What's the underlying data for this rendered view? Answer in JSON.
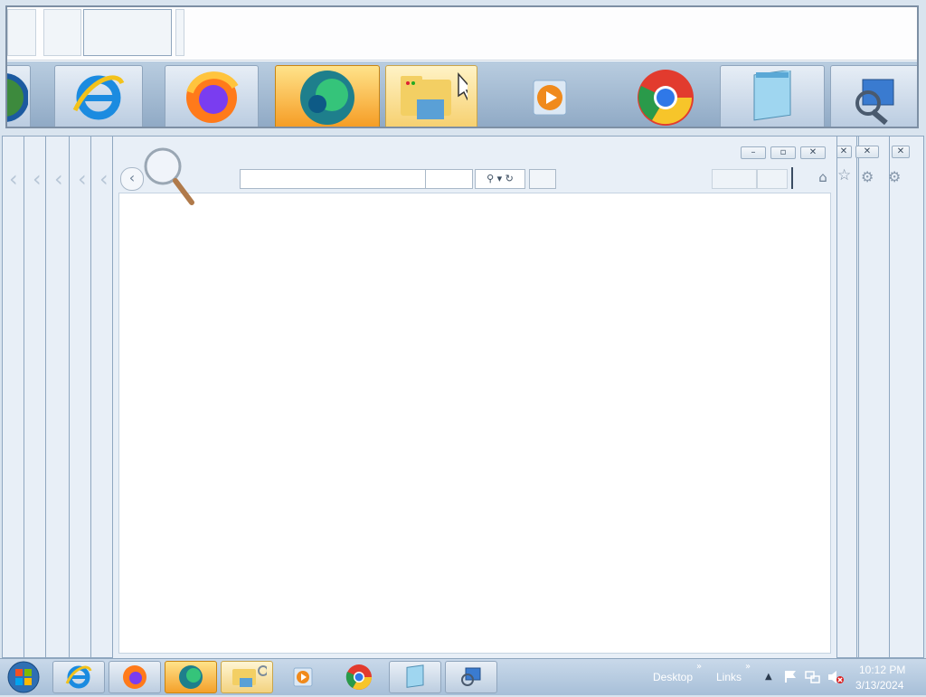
{
  "taskbar": {
    "toolbars": [
      "Desktop",
      "Links"
    ],
    "toolbar_chevron": "»",
    "show_hidden_icons": "▲",
    "clock_time": "10:12 PM",
    "clock_date": "3/13/2024",
    "apps": [
      {
        "name": "internet-explorer",
        "state": "normal"
      },
      {
        "name": "firefox",
        "state": "normal"
      },
      {
        "name": "edge",
        "state": "active"
      },
      {
        "name": "file-explorer",
        "state": "hover"
      },
      {
        "name": "media-player",
        "state": "plain"
      },
      {
        "name": "chrome",
        "state": "plain"
      },
      {
        "name": "notepad",
        "state": "normal"
      },
      {
        "name": "remote-desktop",
        "state": "normal"
      }
    ]
  },
  "window": {
    "minimize_glyph": "–",
    "maximize_glyph": "▫",
    "close_glyph": "✕",
    "search_glyph": "⚲ ▾",
    "refresh_glyph": "↻",
    "home_glyph": "⌂",
    "favorites_glyph": "☆",
    "tools_glyph": "⚙",
    "back_glyph": "‹"
  },
  "colors": {
    "taskbar": "#a7bfd8",
    "active_app": "#f4a02a",
    "window_frame": "#e8eff7"
  }
}
